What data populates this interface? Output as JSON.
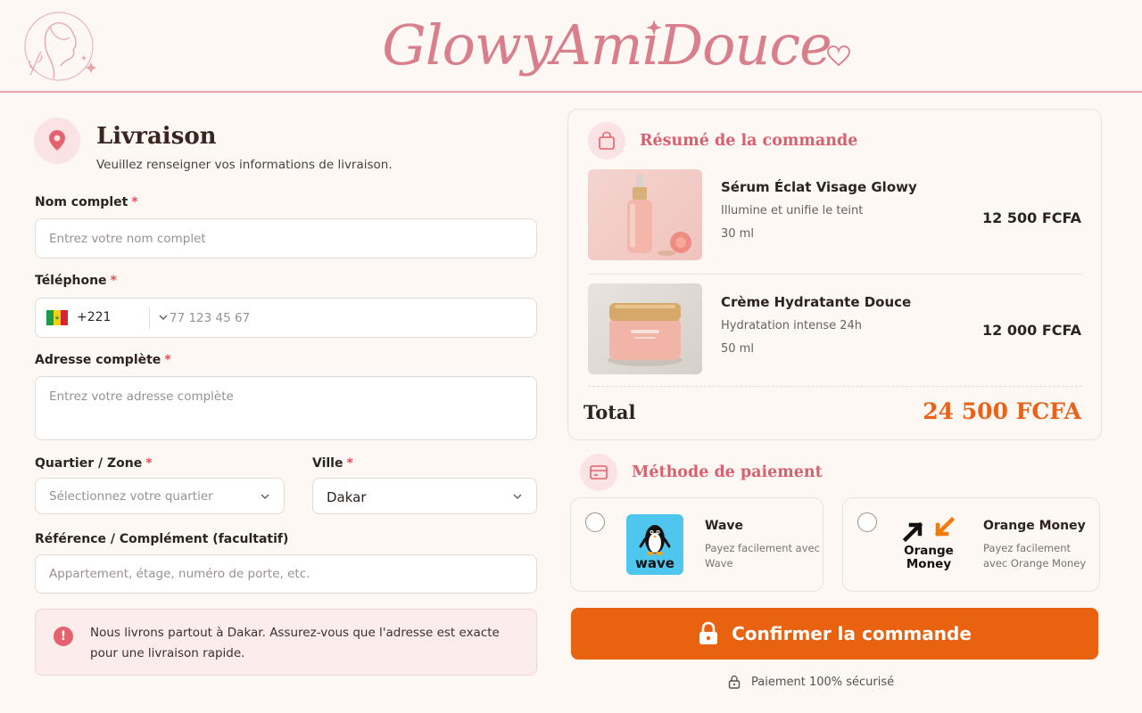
{
  "header": {
    "brand": "GlowyAmiDouce",
    "logo_icon": "woman-face-logo",
    "colors": {
      "brand": "#d97f8c",
      "accent": "#e8620f",
      "rule": "#e9a5ad"
    }
  },
  "delivery": {
    "title": "Livraison",
    "subtitle": "Veuillez renseigner vos informations de livraison.",
    "icon": "map-pin-icon",
    "required_mark": "*",
    "full_name": {
      "label": "Nom complet",
      "placeholder": "Entrez votre nom complet",
      "value": ""
    },
    "phone": {
      "label": "Téléphone",
      "dial_code": "+221",
      "placeholder": "77 123 45 67",
      "value": "",
      "flag": "senegal-flag"
    },
    "address": {
      "label": "Adresse complète",
      "placeholder": "Entrez votre adresse complète",
      "value": ""
    },
    "district": {
      "label": "Quartier / Zone",
      "placeholder": "Sélectionnez votre quartier"
    },
    "city": {
      "label": "Ville",
      "value": "Dakar"
    },
    "reference": {
      "label": "Référence / Complément (facultatif)",
      "placeholder": "Appartement, étage, numéro de porte, etc.",
      "value": ""
    },
    "info": "Nous livrons partout à Dakar. Assurez-vous que l'adresse est exacte pour une livraison rapide."
  },
  "summary": {
    "title": "Résumé de la commande",
    "icon": "shopping-bag-icon",
    "items": [
      {
        "name": "Sérum Éclat Visage Glowy",
        "desc": "Illumine et unifie le teint",
        "size": "30 ml",
        "price": "12 500 FCFA"
      },
      {
        "name": "Crème Hydratante Douce",
        "desc": "Hydratation intense 24h",
        "size": "50 ml",
        "price": "12 000 FCFA"
      }
    ],
    "total_label": "Total",
    "total_value": "24 500 FCFA"
  },
  "payment": {
    "title": "Méthode de paiement",
    "icon": "credit-card-icon",
    "methods": [
      {
        "name": "Wave",
        "desc": "Payez facilement avec Wave",
        "logo_text": "wave"
      },
      {
        "name": "Orange Money",
        "desc": "Payez facilement avec Orange Money",
        "logo_text": "Orange Money"
      }
    ]
  },
  "confirm_label": "Confirmer la commande",
  "secure_label": "Paiement 100% sécurisé"
}
